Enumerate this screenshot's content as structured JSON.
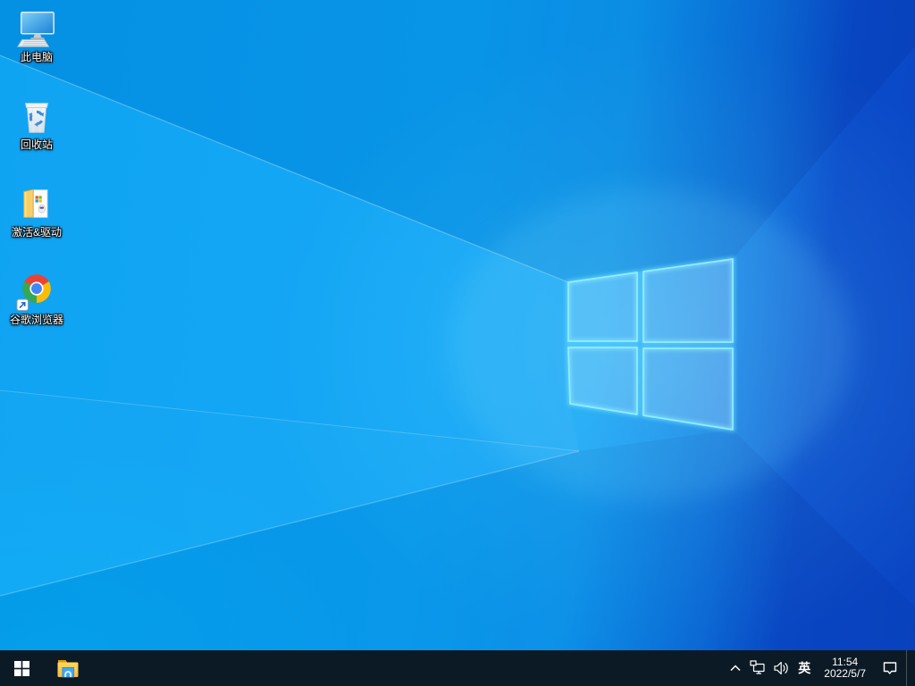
{
  "desktop": {
    "icons": [
      {
        "name": "this-pc",
        "label": "此电脑"
      },
      {
        "name": "recycle-bin",
        "label": "回收站"
      },
      {
        "name": "activation-drivers",
        "label": "激活&驱动"
      },
      {
        "name": "google-chrome",
        "label": "谷歌浏览器"
      }
    ]
  },
  "taskbar": {
    "start_button": {
      "icon": "windows-logo"
    },
    "explorer_button": {
      "icon": "file-explorer-folder"
    },
    "tray": {
      "hidden_icons": {
        "icon": "chevron-up"
      },
      "network": {
        "icon": "ethernet-monitor"
      },
      "volume": {
        "icon": "speaker-waves"
      },
      "input_indicator": "英",
      "clock": {
        "time": "11:54",
        "date": "2022/5/7"
      },
      "action_center": {
        "icon": "speech-bubble"
      }
    },
    "show_desktop": {
      "icon": "show-desktop-strip"
    }
  },
  "colors": {
    "wallpaper_left": "#05a0f2",
    "wallpaper_right": "#0a45c3",
    "taskbar_bg": "#0c1a25",
    "logo_edge": "#8defff",
    "folder_yellow": "#ffd95e",
    "chrome_red": "#ea4335",
    "chrome_green": "#34a853",
    "chrome_yellow": "#fbbc05",
    "chrome_blue": "#4285f4"
  }
}
